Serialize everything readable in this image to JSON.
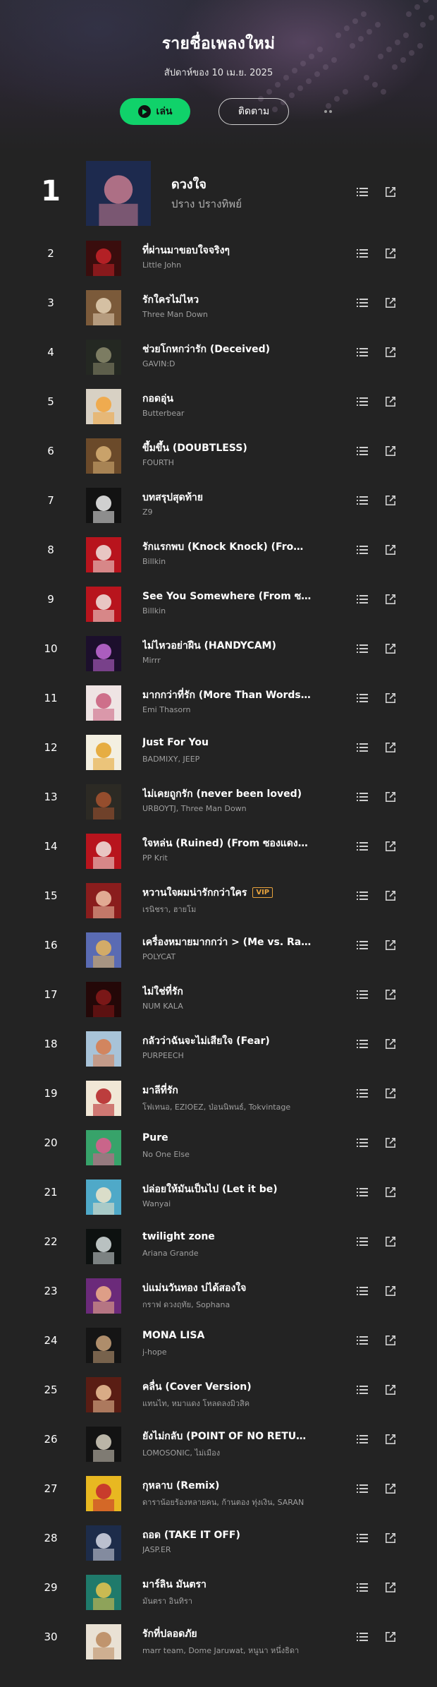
{
  "header": {
    "title": "รายชื่อเพลงใหม่",
    "subtitle": "สัปดาห์ของ 10 เม.ย. 2025",
    "play_label": "เล่น",
    "follow_label": "ติดตาม"
  },
  "colors": {
    "accent": "#10d26a",
    "background": "#232323",
    "vip": "#e8a33d",
    "artist_text": "#9f9f9f"
  },
  "icons": {
    "play": "play-icon",
    "more": "more-dots-icon",
    "queue": "add-to-queue-icon",
    "open": "external-open-icon"
  },
  "tracks": [
    {
      "rank": "1",
      "title": "ดวงใจ",
      "artist": "ปราง ปรางทิพย์",
      "vip": "",
      "cover": [
        "#1d2a4e",
        "#c77b8f"
      ]
    },
    {
      "rank": "2",
      "title": "ที่ผ่านมาขอบใจจริงๆ",
      "artist": "Little John",
      "vip": "",
      "cover": [
        "#3a0d0d",
        "#c9242a"
      ]
    },
    {
      "rank": "3",
      "title": "รักใครไม่ไหว",
      "artist": "Three Man Down",
      "vip": "",
      "cover": [
        "#7b5a3a",
        "#e5d2b6"
      ]
    },
    {
      "rank": "4",
      "title": "ช่วยโกหกว่ารัก (Deceived)",
      "artist": "GAVIN:D",
      "vip": "",
      "cover": [
        "#242822",
        "#8c8b6d"
      ]
    },
    {
      "rank": "5",
      "title": "กอดอุ่น",
      "artist": "Butterbear",
      "vip": "",
      "cover": [
        "#d8d1c4",
        "#f3a43b"
      ]
    },
    {
      "rank": "6",
      "title": "ขึ้มขึ้น (DOUBTLESS)",
      "artist": "FOURTH",
      "vip": "",
      "cover": [
        "#6b4a2a",
        "#d9b276"
      ]
    },
    {
      "rank": "7",
      "title": "บทสรุปสุดท้าย",
      "artist": "Z9",
      "vip": "",
      "cover": [
        "#121212",
        "#f2f2f2"
      ]
    },
    {
      "rank": "8",
      "title": "รักแรกพบ (Knock Knock) (From ...",
      "artist": "Billkin",
      "vip": "",
      "cover": [
        "#b8141d",
        "#f0e5e0"
      ]
    },
    {
      "rank": "9",
      "title": "See You Somewhere (From ซองแ...",
      "artist": "Billkin",
      "vip": "",
      "cover": [
        "#b8141d",
        "#f0e5e0"
      ]
    },
    {
      "rank": "10",
      "title": "ไม่ไหวอย่าฝืน (HANDYCAM)",
      "artist": "Mirrr",
      "vip": "",
      "cover": [
        "#1c0f2c",
        "#c46bd9"
      ]
    },
    {
      "rank": "11",
      "title": "มากกว่าที่รัก (More Than Words) (...",
      "artist": "Emi Thasorn",
      "vip": "",
      "cover": [
        "#efe4e4",
        "#c85a7a"
      ]
    },
    {
      "rank": "12",
      "title": "Just For You",
      "artist": "BADMIXY, JEEP",
      "vip": "",
      "cover": [
        "#f3efe1",
        "#e3a126"
      ]
    },
    {
      "rank": "13",
      "title": "ไม่เคยถูกรัก (never been loved)",
      "artist": "URBOYTJ, Three Man Down",
      "vip": "",
      "cover": [
        "#2c2a24",
        "#a8542f"
      ]
    },
    {
      "rank": "14",
      "title": "ใจหล่น (Ruined) (From ซองแดงแ...",
      "artist": "PP Krit",
      "vip": "",
      "cover": [
        "#b8141d",
        "#f0e5e0"
      ]
    },
    {
      "rank": "15",
      "title": "หวานใจผมน่ารักกว่าใคร",
      "artist": "เรนิชรา, ฮายโม",
      "vip": "VIP",
      "cover": [
        "#8a1d1d",
        "#f0c3a8"
      ]
    },
    {
      "rank": "16",
      "title": "เครื่องหมายมากกว่า > (Me vs. Rain)",
      "artist": "POLYCAT",
      "vip": "",
      "cover": [
        "#5a6bb3",
        "#e8b65a"
      ]
    },
    {
      "rank": "17",
      "title": "ไม่ใช่ที่รัก",
      "artist": "NUM KALA",
      "vip": "",
      "cover": [
        "#240808",
        "#8a1a1a"
      ]
    },
    {
      "rank": "18",
      "title": "กลัวว่าฉันจะไม่เสียใจ (Fear)",
      "artist": "PURPEECH",
      "vip": "",
      "cover": [
        "#a8c3d8",
        "#d97a4a"
      ]
    },
    {
      "rank": "19",
      "title": "มาลีที่รัก",
      "artist": "โฟเทนอ, EZIOEZ, ป่อนนิพนธ์, Tokvintage",
      "vip": "",
      "cover": [
        "#f1e7d6",
        "#b31e22"
      ]
    },
    {
      "rank": "20",
      "title": "Pure",
      "artist": "No One Else",
      "vip": "",
      "cover": [
        "#37a36a",
        "#e35a8f"
      ]
    },
    {
      "rank": "21",
      "title": "ปล่อยให้มันเป็นไป (Let it be)",
      "artist": "Wanyai",
      "vip": "",
      "cover": [
        "#4fa9c8",
        "#f2e6c9"
      ]
    },
    {
      "rank": "22",
      "title": "twilight zone",
      "artist": "Ariana Grande",
      "vip": "",
      "cover": [
        "#0d1110",
        "#d8e0e0"
      ]
    },
    {
      "rank": "23",
      "title": "บ่แม่นวันทอง บ่ได้สองใจ",
      "artist": "กราฟ ดวงฤทัย, Sophana",
      "vip": "",
      "cover": [
        "#6b2a7a",
        "#f2b38a"
      ]
    },
    {
      "rank": "24",
      "title": "MONA LISA",
      "artist": "j-hope",
      "vip": "",
      "cover": [
        "#151515",
        "#c9a27a"
      ]
    },
    {
      "rank": "25",
      "title": "คลื่น (Cover Version)",
      "artist": "แทนไท, หมาแดง โหลดลงมิวสิค",
      "vip": "",
      "cover": [
        "#5a1d14",
        "#f0c49a"
      ]
    },
    {
      "rank": "26",
      "title": "ยังไม่กลับ (POINT OF NO RETURN)",
      "artist": "LOMOSONIC, ไม่เมือง",
      "vip": "",
      "cover": [
        "#131313",
        "#d8d2c2"
      ]
    },
    {
      "rank": "27",
      "title": "กุหลาบ (Remix)",
      "artist": "ดาราน้อยร้องหลายคน, ก้านตอง ทุ่งเงิน, SARAN",
      "vip": "",
      "cover": [
        "#e8b821",
        "#c2262e"
      ]
    },
    {
      "rank": "28",
      "title": "ถอด (TAKE IT OFF)",
      "artist": "JASP.ER",
      "vip": "",
      "cover": [
        "#1d2c4a",
        "#d7dbe6"
      ]
    },
    {
      "rank": "29",
      "title": "มาร์ลิน มันตรา",
      "artist": "มันตรา อินทิรา",
      "vip": "",
      "cover": [
        "#1f7a6b",
        "#e9c54d"
      ]
    },
    {
      "rank": "30",
      "title": "รักที่ปลอดภัย",
      "artist": "marr team, Dome Jaruwat, หนูนา หนึ่งธิดา",
      "vip": "",
      "cover": [
        "#e9e1d4",
        "#b8865a"
      ]
    }
  ]
}
